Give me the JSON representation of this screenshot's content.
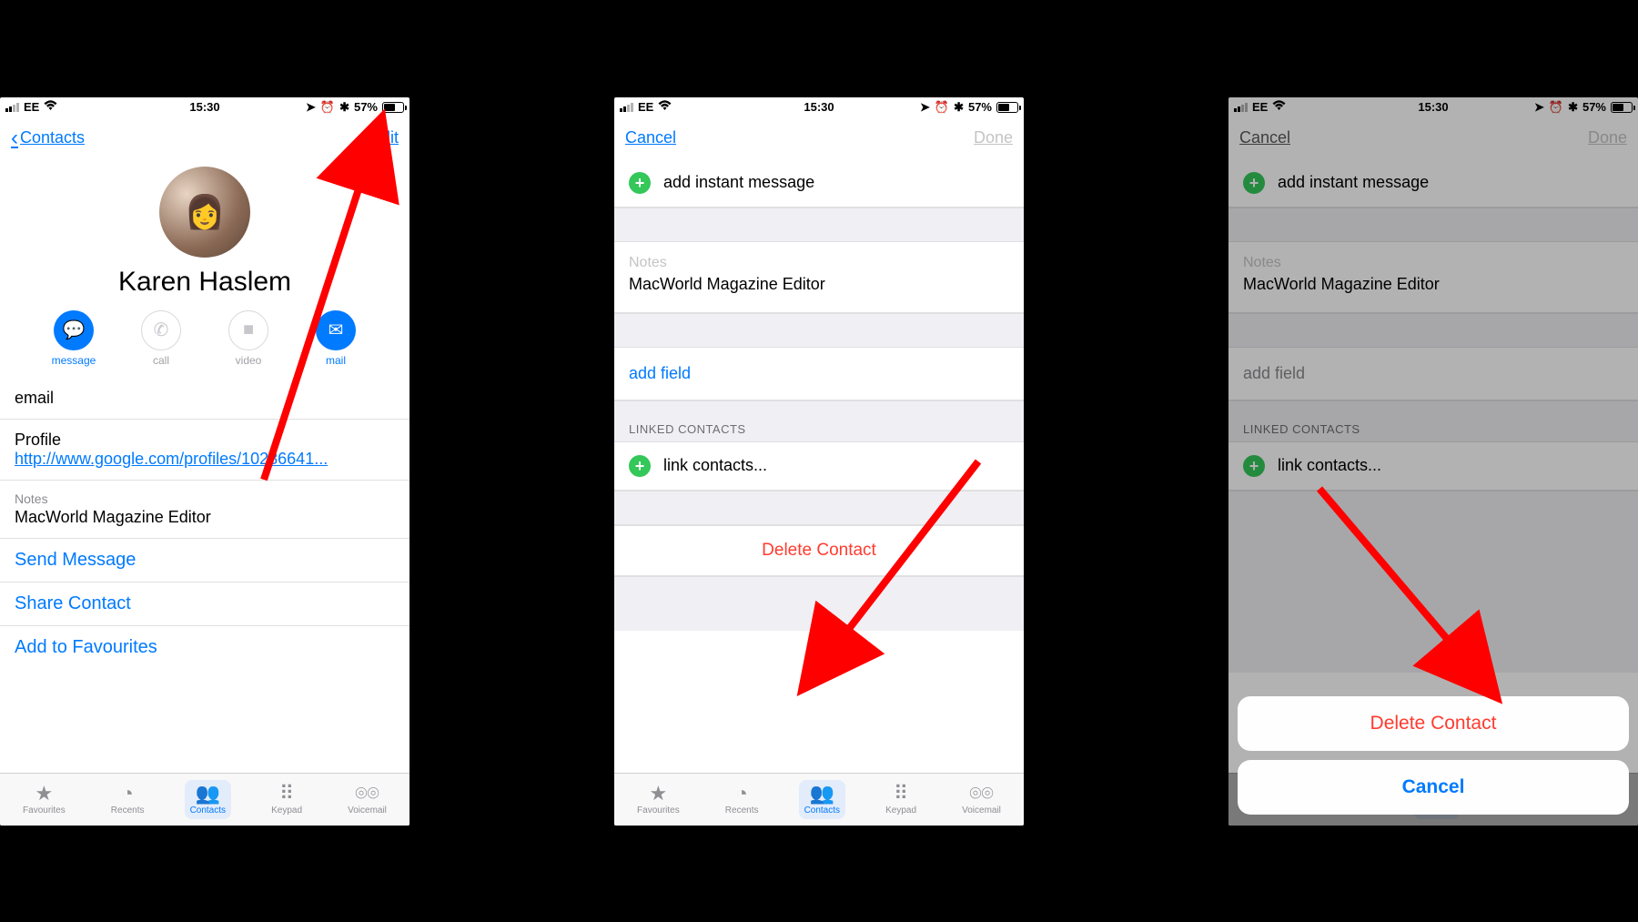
{
  "status": {
    "carrier": "EE",
    "time": "15:30",
    "battery_pct": "57%"
  },
  "screen1": {
    "back_label": "Contacts",
    "edit_label": "Edit",
    "contact_name": "Karen Haslem",
    "actions": {
      "message": "message",
      "call": "call",
      "video": "video",
      "mail": "mail"
    },
    "email_label": "email",
    "profile_label": "Profile",
    "profile_url": "http://www.google.com/profiles/10286641...",
    "notes_label": "Notes",
    "notes_value": "MacWorld Magazine Editor",
    "send_message": "Send Message",
    "share_contact": "Share Contact",
    "add_fav": "Add to Favourites"
  },
  "screen2": {
    "cancel": "Cancel",
    "done": "Done",
    "add_im": "add instant message",
    "notes_label": "Notes",
    "notes_value": "MacWorld Magazine Editor",
    "add_field": "add field",
    "linked_header": "LINKED CONTACTS",
    "link_contacts": "link contacts...",
    "delete": "Delete Contact"
  },
  "screen3": {
    "cancel": "Cancel",
    "done": "Done",
    "add_im": "add instant message",
    "notes_label": "Notes",
    "notes_value": "MacWorld Magazine Editor",
    "add_field": "add field",
    "linked_header": "LINKED CONTACTS",
    "link_contacts": "link contacts...",
    "sheet_delete": "Delete Contact",
    "sheet_cancel": "Cancel"
  },
  "tabs": {
    "favourites": "Favourites",
    "recents": "Recents",
    "contacts": "Contacts",
    "keypad": "Keypad",
    "voicemail": "Voicemail"
  }
}
